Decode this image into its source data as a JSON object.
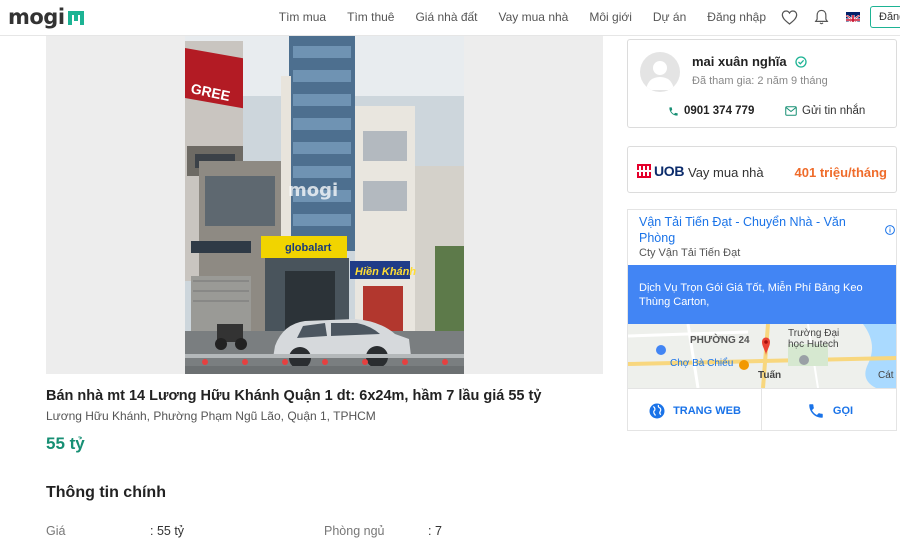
{
  "header": {
    "logo": "mogi",
    "nav": [
      "Tìm mua",
      "Tìm thuê",
      "Giá nhà đất",
      "Vay mua nhà",
      "Môi giới",
      "Dự án",
      "Đăng nhập"
    ],
    "login_button": "Đăng"
  },
  "listing": {
    "title": "Bán nhà mt 14 Lương Hữu Khánh Quận 1 dt: 6x24m, hầm 7 lầu giá 55 tỷ",
    "address": "Lương Hữu Khánh, Phường Phạm Ngũ Lão, Quận 1, TPHCM",
    "price": "55 tỷ",
    "section_title": "Thông tin chính",
    "info": [
      {
        "label": "Giá",
        "value": ": 55 tỷ"
      },
      {
        "label": "Phòng ngủ",
        "value": ": 7"
      }
    ],
    "photo_signs": {
      "gree": "GREE",
      "watermark": "mogi",
      "globalart": "globalart",
      "hien_khanh": "Hiền Khánh"
    }
  },
  "agent": {
    "name": "mai xuân nghĩa",
    "joined": "Đã tham gia: 2 năm 9 tháng",
    "phone": "0901 374 779",
    "message_label": "Gửi tin nhắn"
  },
  "loan": {
    "bank": "UOB",
    "label": "Vay mua nhà",
    "rate": "401 triệu/tháng"
  },
  "ad": {
    "title": "Vận Tải Tiến Đạt - Chuyển Nhà - Văn Phòng",
    "advertiser": "Cty Vận Tải Tiến Đạt",
    "banner": "Dịch Vụ Trọn Gói Giá Tốt, Miễn Phí Băng Keo Thùng Carton,",
    "map_labels": {
      "ward": "PHƯỜNG 24",
      "market": "Chợ Bà Chiểu",
      "school": "Trường Đại học Hutech",
      "tuan": "Tuấn",
      "cat": "Cát"
    },
    "website_button": "TRANG WEB",
    "call_button": "GỌI"
  },
  "colors": {
    "brand_green": "#1db394",
    "price_green": "#178f74",
    "loan_orange": "#ef6c2b",
    "ad_blue": "#4285f4",
    "link_blue": "#1a73e8"
  }
}
